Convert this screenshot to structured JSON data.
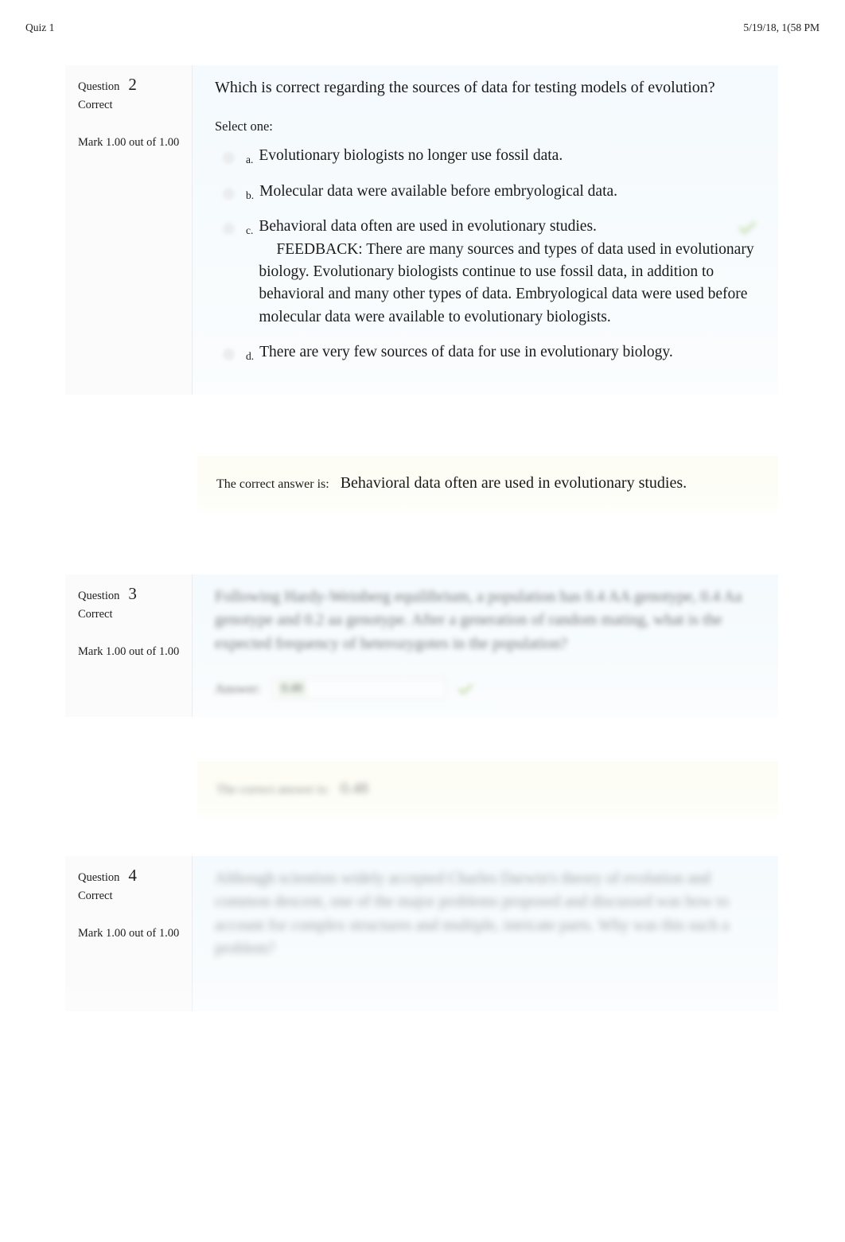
{
  "header": {
    "title": "Quiz 1",
    "timestamp": "5/19/18, 1(58 PM"
  },
  "questions": [
    {
      "label": "Question",
      "number": "2",
      "status": "Correct",
      "mark": "Mark 1.00 out of 1.00",
      "text": "Which is correct regarding the sources of data for testing models of evolution?",
      "select_prompt": "Select one:",
      "options": [
        {
          "letter": "a.",
          "text": "Evolutionary biologists no longer use fossil data."
        },
        {
          "letter": "b.",
          "text": "Molecular data were available before embryological data."
        },
        {
          "letter": "c.",
          "text": "Behavioral data often are used in evolutionary studies.",
          "feedback": "FEEDBACK: There are many sources and types of data used in evolutionary biology. Evolutionary biologists continue to use fossil data, in addition to behavioral and many other types of data. Embryological data were used before molecular data were available to evolutionary biologists.",
          "selected_correct": true
        },
        {
          "letter": "d.",
          "text": "There are very few sources of data for use in evolutionary biology."
        }
      ],
      "correct_answer_lead": "The correct answer is:",
      "correct_answer_value": "Behavioral data often are used in evolutionary studies."
    },
    {
      "label": "Question",
      "number": "3",
      "status": "Correct",
      "mark": "Mark 1.00 out of 1.00",
      "text": "Following Hardy-Weinberg equilibrium, a population has 0.4 AA genotype, 0.4 Aa genotype and 0.2 aa genotype. After a generation of random mating, what is the expected frequency of heterozygotes in the population?",
      "answer_label": "Answer:",
      "answer_value": "0.48",
      "correct_answer_lead": "The correct answer is:",
      "correct_answer_value": "0.48"
    },
    {
      "label": "Question",
      "number": "4",
      "status": "Correct",
      "mark": "Mark 1.00 out of 1.00",
      "text": "Although scientists widely accepted Charles Darwin's theory of evolution and common descent, one of the major problems proposed and discussed was how to account for complex structures and multiple, intricate parts. Why was this such a problem?"
    }
  ],
  "icons": {
    "correct_check": "check-icon"
  },
  "colors": {
    "question_bg": "#f4fafd",
    "answer_bg": "#fdfdf5",
    "check_green": "#9ac46a",
    "text": "#1a1a1a"
  }
}
